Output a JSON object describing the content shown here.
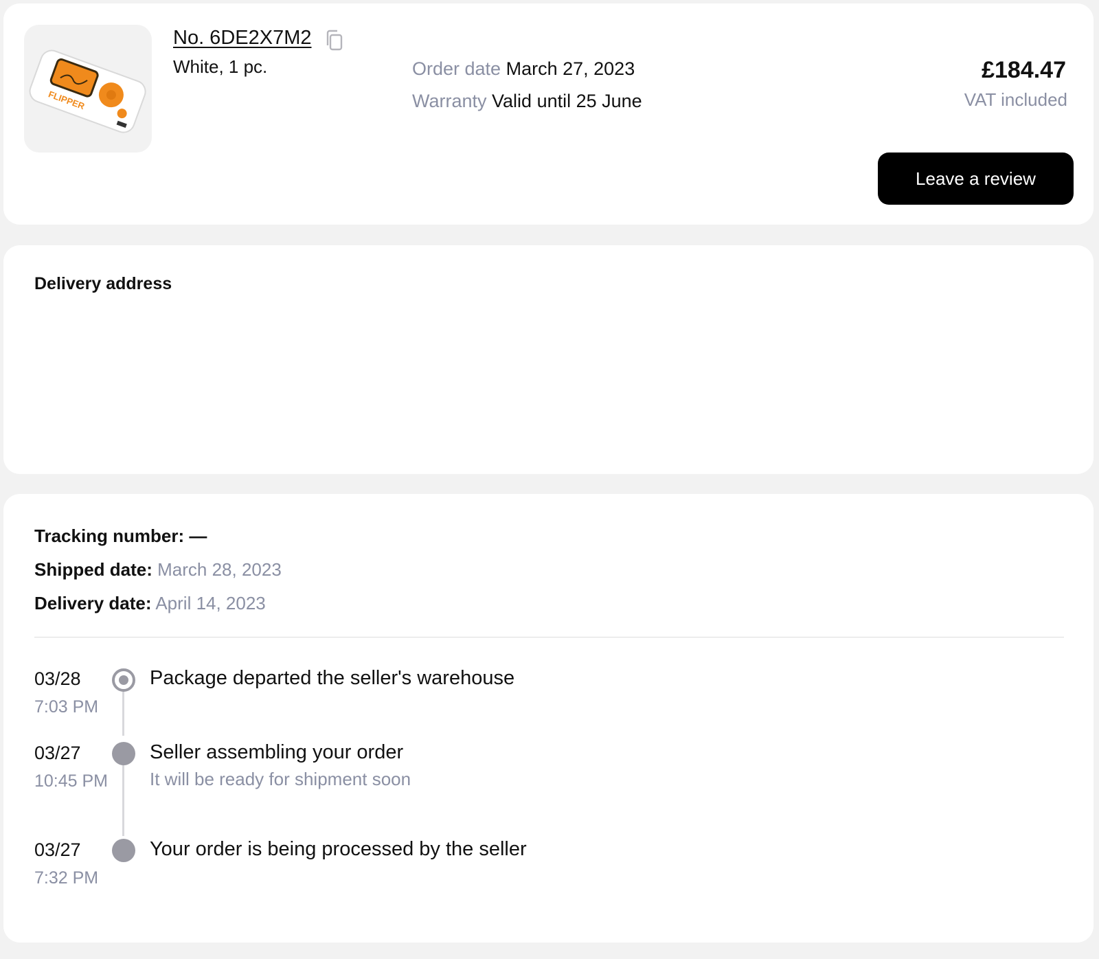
{
  "order": {
    "number": "No. 6DE2X7M2",
    "variant": "White, 1 pc.",
    "order_date_label": "Order date",
    "order_date": "March 27, 2023",
    "warranty_label": "Warranty",
    "warranty": "Valid until 25 June",
    "price": "£184.47",
    "vat": "VAT included",
    "review_button": "Leave a review",
    "product_image_text": "FLIPPER",
    "icons": [
      "product-image",
      "copy-icon"
    ]
  },
  "address": {
    "title": "Delivery address"
  },
  "tracking": {
    "tracking_label": "Tracking number:",
    "tracking_value": "—",
    "shipped_label": "Shipped date:",
    "shipped_value": "March 28, 2023",
    "delivery_label": "Delivery date:",
    "delivery_value": "April 14, 2023",
    "events": [
      {
        "date": "03/28",
        "time": "7:03 PM",
        "title": "Package departed the seller's warehouse",
        "subtitle": "",
        "current": true
      },
      {
        "date": "03/27",
        "time": "10:45 PM",
        "title": "Seller assembling your order",
        "subtitle": "It will be ready for shipment soon",
        "current": false
      },
      {
        "date": "03/27",
        "time": "7:32 PM",
        "title": "Your order is being processed by the seller",
        "subtitle": "",
        "current": false
      }
    ]
  },
  "colors": {
    "page_bg": "#f2f2f2",
    "card_bg": "#ffffff",
    "muted_text": "#8a8fa3",
    "button_bg": "#000000",
    "timeline_dot": "#9a9aa3",
    "product_accent": "#f08a1c"
  }
}
